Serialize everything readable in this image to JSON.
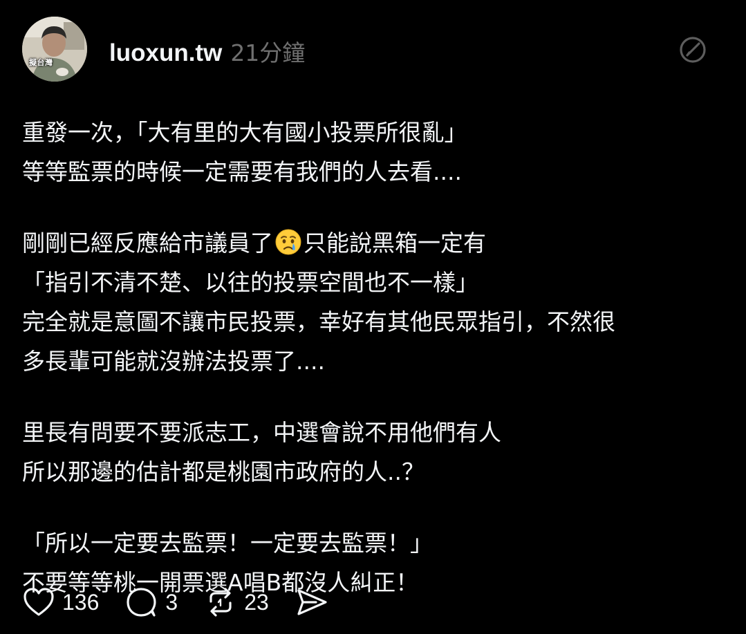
{
  "post": {
    "avatar_label": "擬台灣",
    "username": "luoxun.tw",
    "timestamp": "21分鐘",
    "paragraphs": [
      {
        "lines": [
          "重發一次，「大有里的大有國小投票所很亂」",
          "等等監票的時候一定需要有我們的人去看...."
        ]
      },
      {
        "lines": [
          "剛剛已經反應給市議員了",
          "只能說黑箱一定有"
        ]
      },
      {
        "lines": [
          "「指引不清不楚、以往的投票空間也不一樣」",
          "完全就是意圖不讓市民投票，幸好有其他民眾指引，不然很",
          "多長輩可能就沒辦法投票了...."
        ]
      },
      {
        "lines": [
          "里長有問要不要派志工，中選會說不用他們有人",
          "所以那邊的估計都是桃園市政府的人..？"
        ]
      },
      {
        "lines": [
          "「所以一定要去監票！一定要去監票！」",
          "不要等等桃一開票選A唱B都沒人糾正！"
        ]
      }
    ],
    "emoji": "crying-face-emoji"
  },
  "actions": {
    "likes": "136",
    "replies": "3",
    "reposts": "23"
  },
  "colors": {
    "background": "#000000",
    "text": "#f3f5f7",
    "muted": "#6f6f6f"
  }
}
